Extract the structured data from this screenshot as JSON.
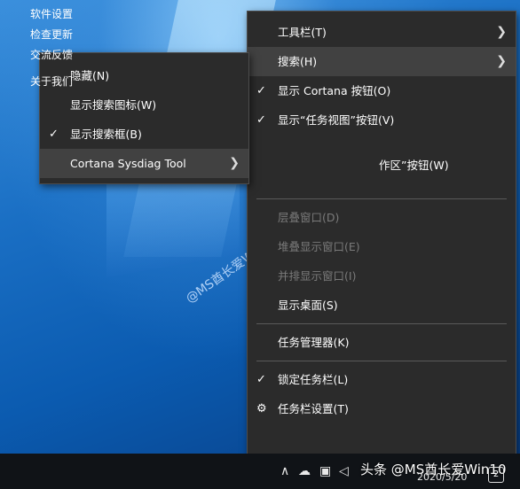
{
  "main_menu": {
    "items": [
      {
        "label": "工具栏(T)",
        "checked": false,
        "submenu": true,
        "disabled": false
      },
      {
        "label": "搜索(H)",
        "checked": false,
        "submenu": true,
        "disabled": false,
        "highlighted": true
      },
      {
        "label": "显示 Cortana 按钮(O)",
        "checked": true,
        "submenu": false,
        "disabled": false
      },
      {
        "label": "显示“任务视图”按钮(V)",
        "checked": true,
        "submenu": false,
        "disabled": false
      },
      {
        "label": "作区”按钮(W)",
        "checked": false,
        "submenu": false,
        "disabled": false
      },
      {
        "label": "层叠窗口(D)",
        "checked": false,
        "submenu": false,
        "disabled": true
      },
      {
        "label": "堆叠显示窗口(E)",
        "checked": false,
        "submenu": false,
        "disabled": true
      },
      {
        "label": "并排显示窗口(I)",
        "checked": false,
        "submenu": false,
        "disabled": true
      },
      {
        "label": "显示桌面(S)",
        "checked": false,
        "submenu": false,
        "disabled": false
      },
      {
        "label": "任务管理器(K)",
        "checked": false,
        "submenu": false,
        "disabled": false
      },
      {
        "label": "锁定任务栏(L)",
        "checked": true,
        "submenu": false,
        "disabled": false
      },
      {
        "label": "任务栏设置(T)",
        "checked": false,
        "submenu": false,
        "disabled": false,
        "icon": "gear-icon"
      }
    ]
  },
  "search_submenu": {
    "items": [
      {
        "label": "隐藏(N)",
        "checked": false
      },
      {
        "label": "显示搜索图标(W)",
        "checked": false
      },
      {
        "label": "显示搜索框(B)",
        "checked": true
      },
      {
        "label": "Cortana Sysdiag Tool",
        "checked": false,
        "submenu": true,
        "highlighted": true
      }
    ]
  },
  "tool_submenu": {
    "items": [
      "软件设置",
      "检查更新",
      "交流反馈"
    ],
    "about": "关于我们"
  },
  "watermarks": {
    "middle": "@MS酋长爱Win10",
    "bottom": "头条 @MS酋长爱Win10"
  },
  "taskbar": {
    "date": "2020/5/20",
    "notification_count": "2",
    "icons": [
      "chevron-up-icon",
      "cloud-icon",
      "network-icon",
      "volume-icon",
      "ime-icon"
    ]
  }
}
